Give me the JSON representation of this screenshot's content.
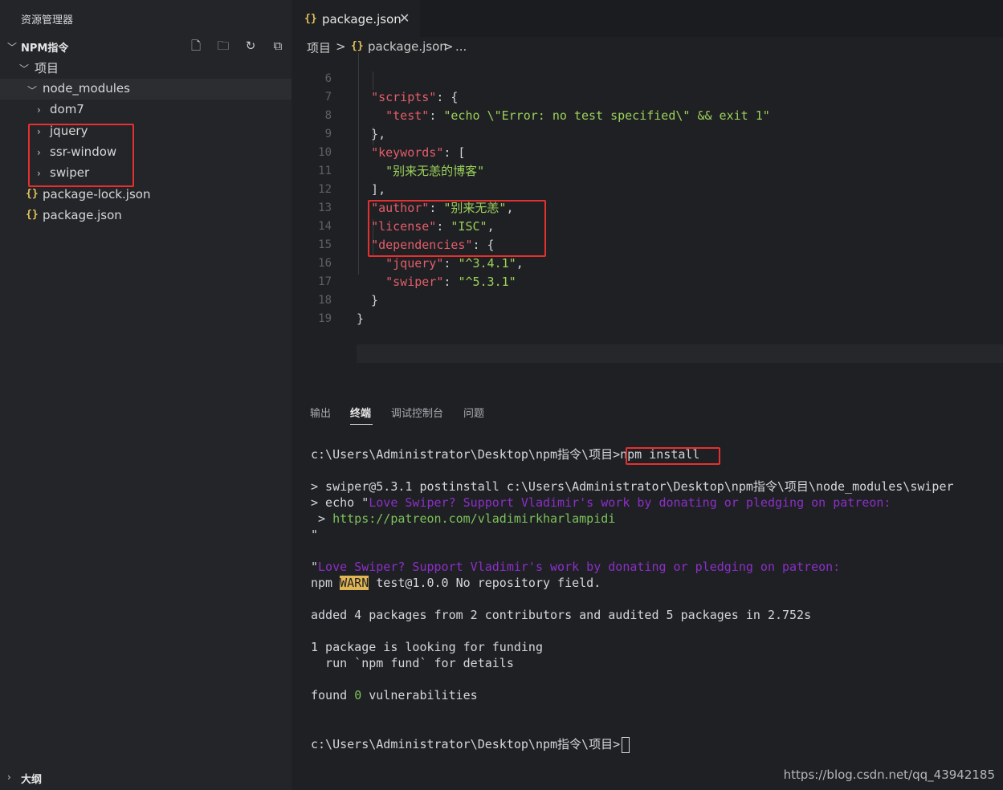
{
  "sidebar": {
    "title": "资源管理器",
    "project_header": "NPM指令",
    "tree": [
      {
        "label": "项目",
        "type": "folder",
        "expanded": true
      },
      {
        "label": "node_modules",
        "type": "folder",
        "expanded": true
      },
      {
        "label": "dom7",
        "type": "folder",
        "expanded": false
      },
      {
        "label": "jquery",
        "type": "folder",
        "expanded": false
      },
      {
        "label": "ssr-window",
        "type": "folder",
        "expanded": false
      },
      {
        "label": "swiper",
        "type": "folder",
        "expanded": false
      },
      {
        "label": "package-lock.json",
        "type": "json"
      },
      {
        "label": "package.json",
        "type": "json"
      }
    ],
    "outline_label": "大纲"
  },
  "editor": {
    "tab": {
      "name": "package.json",
      "close_glyph": "✕",
      "icon_glyph": "{}"
    },
    "breadcrumb": {
      "part1": "项目",
      "sep": ">",
      "file_icon": "{}",
      "part2": "package.json",
      "part3": "..."
    },
    "lines": [
      {
        "n": "6",
        "text": "  \"scripts\": {"
      },
      {
        "n": "7",
        "text": "    \"test\": \"echo \\\"Error: no test specified\\\" && exit 1\""
      },
      {
        "n": "8",
        "text": "  },"
      },
      {
        "n": "9",
        "text": "  \"keywords\": ["
      },
      {
        "n": "10",
        "text": "    \"别来无恙的博客\""
      },
      {
        "n": "11",
        "text": "  ],"
      },
      {
        "n": "12",
        "text": "  \"author\": \"别来无恙\","
      },
      {
        "n": "13",
        "text": "  \"license\": \"ISC\","
      },
      {
        "n": "14",
        "text": "  \"dependencies\": {"
      },
      {
        "n": "15",
        "text": "    \"jquery\": \"^3.4.1\","
      },
      {
        "n": "16",
        "text": "    \"swiper\": \"^5.3.1\""
      },
      {
        "n": "17",
        "text": "  }"
      },
      {
        "n": "18",
        "text": "}"
      },
      {
        "n": "19",
        "text": ""
      }
    ]
  },
  "panel": {
    "tabs": [
      "输出",
      "终端",
      "调试控制台",
      "问题"
    ],
    "active_tab": "终端",
    "terminal": {
      "l1_prompt": "c:\\Users\\Administrator\\Desktop\\npm指令\\项目>",
      "l1_cmd": "npm install",
      "l2": "> swiper@5.3.1 postinstall c:\\Users\\Administrator\\Desktop\\npm指令\\项目\\node_modules\\swiper",
      "l3_a": "> echo \"",
      "l3_b": "Love Swiper? Support Vladimir's work by donating or pledging on patreon:",
      "l4_a": " > ",
      "l4_b": "https://patreon.com/vladimirkharlampidi",
      "l5": "\"",
      "l6_a": "\"",
      "l6_b": "Love Swiper? Support Vladimir's work by donating or pledging on patreon:",
      "l7_a": "npm ",
      "l7_warn": "WARN",
      "l7_b": " test@1.0.0 No repository field.",
      "l8": "added 4 packages from 2 contributors and audited 5 packages in 2.752s",
      "l9": "1 package is looking for funding",
      "l10": "  run `npm fund` for details",
      "l11_a": "found ",
      "l11_n": "0",
      "l11_b": " vulnerabilities",
      "l12_prompt": "c:\\Users\\Administrator\\Desktop\\npm指令\\项目>"
    }
  },
  "watermark": "https://blog.csdn.net/qq_43942185",
  "colors": {
    "highlight_box": "#e53030",
    "json_icon": "#e2c15a",
    "key": "#e35d6a",
    "string": "#9bd15b",
    "purple": "#8b2fc9"
  }
}
